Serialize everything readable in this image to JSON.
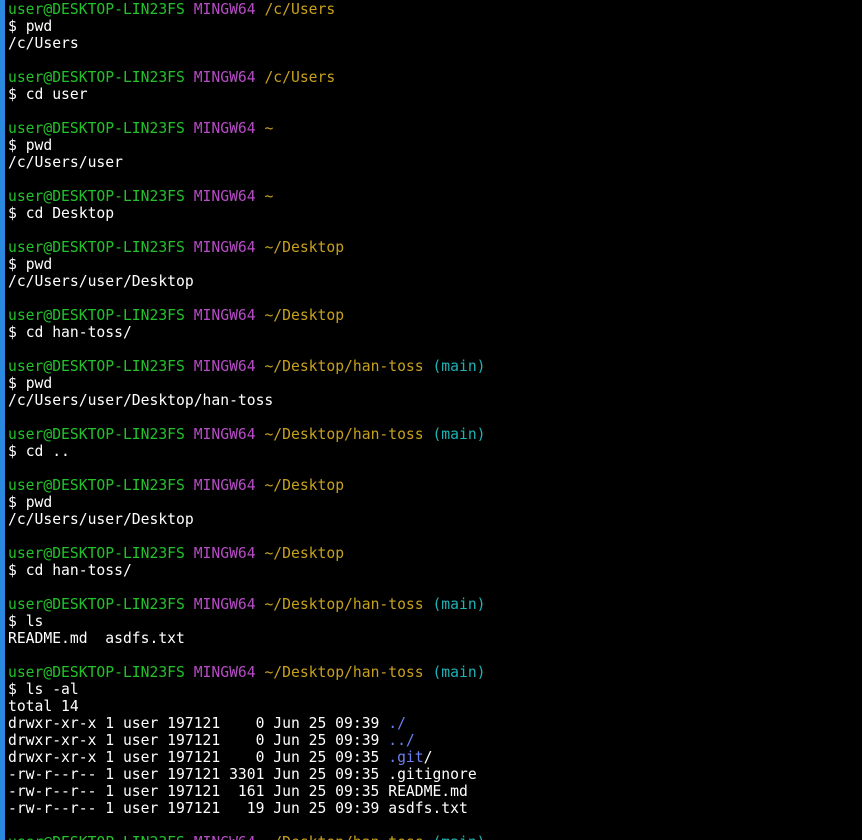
{
  "colors": {
    "background": "#000000",
    "user_host": "#23c22b",
    "msystem": "#b64cc5",
    "path": "#c7a11c",
    "branch": "#1fb3b6",
    "directory": "#6b80f2",
    "text": "#ffffff",
    "window_edge": "#2b8ae0"
  },
  "prompt": {
    "user_host": "user@DESKTOP-LIN23FS",
    "msystem": "MINGW64",
    "symbol": "$"
  },
  "blocks": [
    {
      "path": "/c/Users",
      "branch": "",
      "command": "pwd",
      "output": [
        "/c/Users"
      ]
    },
    {
      "path": "/c/Users",
      "branch": "",
      "command": "cd user",
      "output": []
    },
    {
      "path": "~",
      "branch": "",
      "command": "pwd",
      "output": [
        "/c/Users/user"
      ]
    },
    {
      "path": "~",
      "branch": "",
      "command": "cd Desktop",
      "output": []
    },
    {
      "path": "~/Desktop",
      "branch": "",
      "command": "pwd",
      "output": [
        "/c/Users/user/Desktop"
      ]
    },
    {
      "path": "~/Desktop",
      "branch": "",
      "command": "cd han-toss/",
      "output": []
    },
    {
      "path": "~/Desktop/han-toss",
      "branch": "(main)",
      "command": "pwd",
      "output": [
        "/c/Users/user/Desktop/han-toss"
      ]
    },
    {
      "path": "~/Desktop/han-toss",
      "branch": "(main)",
      "command": "cd ..",
      "output": []
    },
    {
      "path": "~/Desktop",
      "branch": "",
      "command": "pwd",
      "output": [
        "/c/Users/user/Desktop"
      ]
    },
    {
      "path": "~/Desktop",
      "branch": "",
      "command": "cd han-toss/",
      "output": []
    },
    {
      "path": "~/Desktop/han-toss",
      "branch": "(main)",
      "command": "ls",
      "output": [
        "README.md  asdfs.txt"
      ]
    },
    {
      "path": "~/Desktop/han-toss",
      "branch": "(main)",
      "command": "ls -al",
      "output": [
        "total 14"
      ]
    }
  ],
  "listing": [
    {
      "meta": "drwxr-xr-x 1 user 197121    0 Jun 25 09:39 ",
      "name": "./",
      "dir": true
    },
    {
      "meta": "drwxr-xr-x 1 user 197121    0 Jun 25 09:39 ",
      "name": "../",
      "dir": true
    },
    {
      "meta": "drwxr-xr-x 1 user 197121    0 Jun 25 09:35 ",
      "name": ".git",
      "suffix": "/",
      "dir": true
    },
    {
      "meta": "-rw-r--r-- 1 user 197121 3301 Jun 25 09:35 ",
      "name": ".gitignore",
      "dir": false
    },
    {
      "meta": "-rw-r--r-- 1 user 197121  161 Jun 25 09:35 ",
      "name": "README.md",
      "dir": false
    },
    {
      "meta": "-rw-r--r-- 1 user 197121   19 Jun 25 09:39 ",
      "name": "asdfs.txt",
      "dir": false
    }
  ],
  "trailing_prompt": {
    "path": "~/Desktop/han-toss",
    "branch": "(main)"
  }
}
